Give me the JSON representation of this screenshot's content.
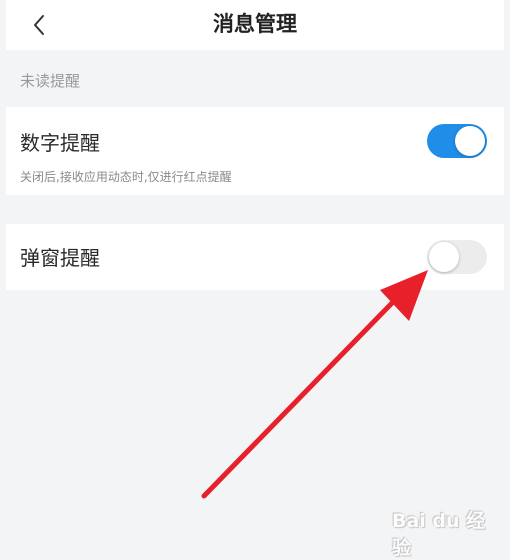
{
  "header": {
    "title": "消息管理",
    "back_icon": "chevron-left-icon"
  },
  "section": {
    "label": "未读提醒"
  },
  "items": [
    {
      "label": "数字提醒",
      "description": "关闭后,接收应用动态时,仅进行红点提醒",
      "toggle_on": true
    },
    {
      "label": "弹窗提醒",
      "toggle_on": false
    }
  ],
  "annotation": {
    "arrow_color": "#e8202a"
  },
  "colors": {
    "accent": "#1f8ee8",
    "toggle_off": "#ececec",
    "background": "#f3f4f6"
  },
  "watermark": {
    "text": "Bai du 经验"
  }
}
